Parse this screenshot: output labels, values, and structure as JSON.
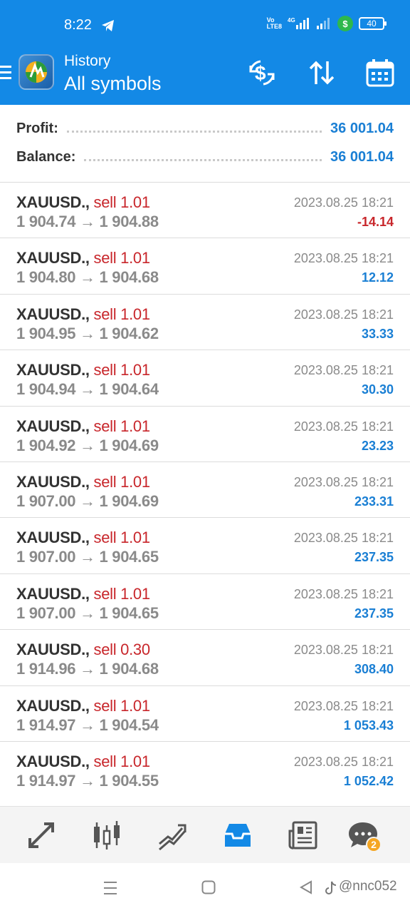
{
  "status": {
    "time": "8:22",
    "battery": "40",
    "shield": "$",
    "network": "4G",
    "volte_top": "Vo",
    "volte_bottom": "LTE8"
  },
  "header": {
    "subtitle": "History",
    "title": "All symbols",
    "icons": [
      "menu-icon",
      "metatrader-logo",
      "deposit-icon",
      "sort-icon",
      "calendar-icon"
    ]
  },
  "summary": {
    "profit_label": "Profit:",
    "profit_value": "36 001.04",
    "balance_label": "Balance:",
    "balance_value": "36 001.04"
  },
  "deals": [
    {
      "symbol": "XAUUSD.,",
      "side": "sell 1.01",
      "prices": "1 904.74 → 1 904.88",
      "time": "2023.08.25 18:21",
      "profit": "-14.14",
      "profit_sign": "neg"
    },
    {
      "symbol": "XAUUSD.,",
      "side": "sell 1.01",
      "prices": "1 904.80 → 1 904.68",
      "time": "2023.08.25 18:21",
      "profit": "12.12",
      "profit_sign": "pos"
    },
    {
      "symbol": "XAUUSD.,",
      "side": "sell 1.01",
      "prices": "1 904.95 → 1 904.62",
      "time": "2023.08.25 18:21",
      "profit": "33.33",
      "profit_sign": "pos"
    },
    {
      "symbol": "XAUUSD.,",
      "side": "sell 1.01",
      "prices": "1 904.94 → 1 904.64",
      "time": "2023.08.25 18:21",
      "profit": "30.30",
      "profit_sign": "pos"
    },
    {
      "symbol": "XAUUSD.,",
      "side": "sell 1.01",
      "prices": "1 904.92 → 1 904.69",
      "time": "2023.08.25 18:21",
      "profit": "23.23",
      "profit_sign": "pos"
    },
    {
      "symbol": "XAUUSD.,",
      "side": "sell 1.01",
      "prices": "1 907.00 → 1 904.69",
      "time": "2023.08.25 18:21",
      "profit": "233.31",
      "profit_sign": "pos"
    },
    {
      "symbol": "XAUUSD.,",
      "side": "sell 1.01",
      "prices": "1 907.00 → 1 904.65",
      "time": "2023.08.25 18:21",
      "profit": "237.35",
      "profit_sign": "pos"
    },
    {
      "symbol": "XAUUSD.,",
      "side": "sell 1.01",
      "prices": "1 907.00 → 1 904.65",
      "time": "2023.08.25 18:21",
      "profit": "237.35",
      "profit_sign": "pos"
    },
    {
      "symbol": "XAUUSD.,",
      "side": "sell 0.30",
      "prices": "1 914.96 → 1 904.68",
      "time": "2023.08.25 18:21",
      "profit": "308.40",
      "profit_sign": "pos"
    },
    {
      "symbol": "XAUUSD.,",
      "side": "sell 1.01",
      "prices": "1 914.97 → 1 904.54",
      "time": "2023.08.25 18:21",
      "profit": "1 053.43",
      "profit_sign": "pos"
    },
    {
      "symbol": "XAUUSD.,",
      "side": "sell 1.01",
      "prices": "1 914.97 → 1 904.55",
      "time": "2023.08.25 18:21",
      "profit": "1 052.42",
      "profit_sign": "pos"
    }
  ],
  "bottom_nav": {
    "items": [
      "quotes-icon",
      "chart-icon",
      "trade-icon",
      "history-icon",
      "news-icon",
      "chat-icon"
    ],
    "active": "history-icon",
    "chat_badge": "2"
  },
  "system_nav": {
    "watermark": "@nnc052"
  },
  "colors": {
    "accent": "#1389e6",
    "profit_positive": "#1a7fd4",
    "profit_negative": "#c8262b",
    "sell": "#c8262b"
  }
}
